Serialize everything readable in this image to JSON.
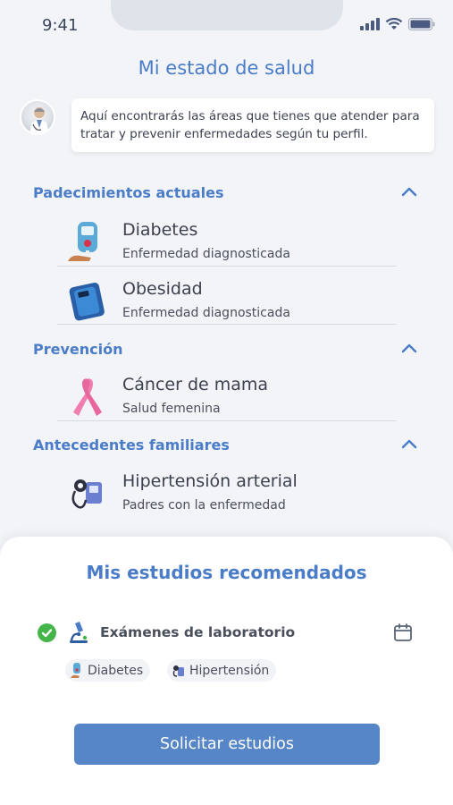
{
  "status_bar": {
    "time": "9:41"
  },
  "header": {
    "title": "Mi estado de salud"
  },
  "intro": {
    "message": "Aquí encontrarás las áreas que tienes que atender para tratar y prevenir enfermedades según tu perfil."
  },
  "sections": [
    {
      "title": "Padecimientos actuales",
      "items": [
        {
          "name": "Diabetes",
          "subtitle": "Enfermedad diagnosticada",
          "icon": "glucometer-icon"
        },
        {
          "name": "Obesidad",
          "subtitle": "Enfermedad diagnosticada",
          "icon": "scale-icon"
        }
      ]
    },
    {
      "title": "Prevención",
      "items": [
        {
          "name": "Cáncer de mama",
          "subtitle": "Salud femenina",
          "icon": "pink-ribbon-icon"
        }
      ]
    },
    {
      "title": "Antecedentes familiares",
      "items": [
        {
          "name": "Hipertensión arterial",
          "subtitle": "Padres con la enfermedad",
          "icon": "blood-pressure-monitor-icon"
        }
      ]
    }
  ],
  "studies": {
    "title": "Mis estudios recomendados",
    "exam_label": "Exámenes de laboratorio",
    "tags": [
      "Diabetes",
      "Hipertensión"
    ],
    "button_label": "Solicitar estudios"
  },
  "colors": {
    "accent": "#4a7cc7",
    "button": "#5686c7",
    "check": "#44b649",
    "background": "#f2f4f8"
  }
}
